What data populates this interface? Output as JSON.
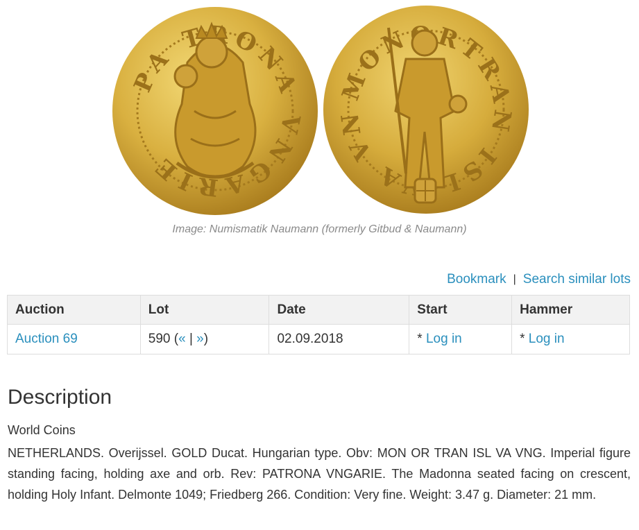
{
  "image": {
    "caption": "Image: Numismatik Naumann (formerly Gitbud & Naumann)",
    "obverse_legend": "PA TRONA VNGARIE",
    "reverse_legend": "MONORTRAN ISL VA VNG"
  },
  "actions": {
    "bookmark": "Bookmark",
    "separator": "|",
    "search_similar": "Search similar lots"
  },
  "table": {
    "headers": [
      "Auction",
      "Lot",
      "Date",
      "Start",
      "Hammer"
    ],
    "row": {
      "auction": "Auction 69",
      "lot_number": "590 (",
      "lot_prev": "«",
      "lot_sep": "|",
      "lot_next": "»",
      "lot_close": ")",
      "date": "02.09.2018",
      "start_prefix": "* ",
      "start_link": "Log in",
      "hammer_prefix": "* ",
      "hammer_link": "Log in"
    }
  },
  "description": {
    "title": "Description",
    "category": "World Coins",
    "text": "NETHERLANDS. Overijssel. GOLD Ducat. Hungarian type. Obv: MON OR TRAN ISL VA VNG. Imperial figure standing facing, holding axe and orb. Rev: PATRONA VNGARIE. The Madonna seated facing on crescent, holding Holy Infant. Delmonte 1049; Friedberg 266. Condition: Very fine. Weight: 3.47 g. Diameter: 21 mm."
  },
  "colors": {
    "link": "#2a8fbd",
    "gold_light": "#e8c95a",
    "gold_dark": "#b8891f"
  }
}
